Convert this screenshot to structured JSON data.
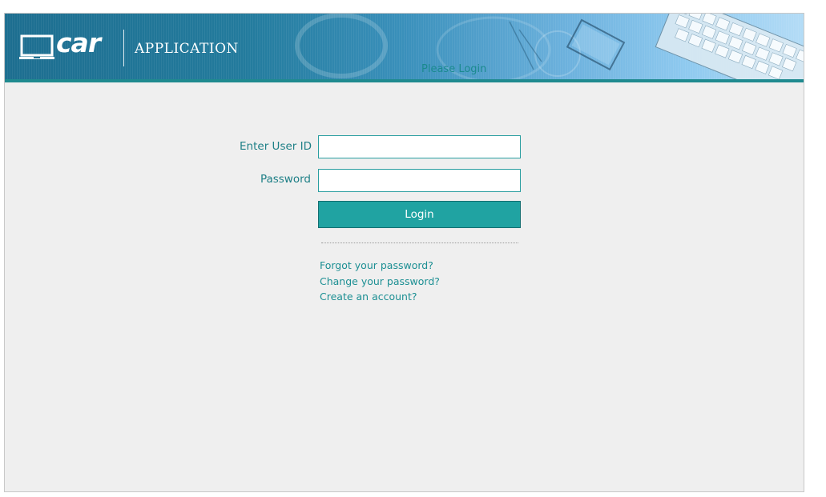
{
  "header": {
    "brand_logo_text": "car",
    "app_title": "APPLICATION",
    "prompt": "Please Login"
  },
  "form": {
    "user_id_label": "Enter User ID",
    "user_id_value": "",
    "password_label": "Password",
    "password_value": "",
    "login_label": "Login"
  },
  "links": {
    "forgot_password": "Forgot your password?",
    "change_password": "Change your password?",
    "create_account": "Create an account?"
  },
  "colors": {
    "accent": "#20a3a2",
    "text": "#1d7f86",
    "background": "#efefef"
  },
  "icons": {
    "logo": "laptop-icon"
  }
}
